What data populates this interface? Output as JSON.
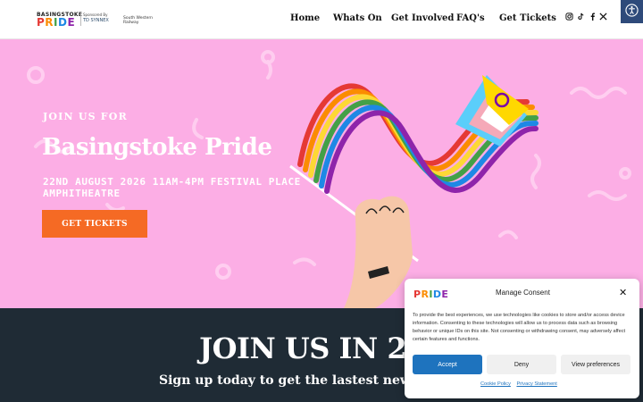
{
  "header": {
    "logo_top": "BASINGSTOKE",
    "logo_letters": [
      "P",
      "R",
      "I",
      "D",
      "E"
    ],
    "sponsored_by": "Sponsored By",
    "sponsor_1": "TD SYNNEX",
    "sponsor_2": "South Western Railway",
    "nav": [
      "Home",
      "Whats On",
      "Get Involved",
      "FAQ's",
      "Get Tickets"
    ],
    "socials": [
      "instagram-icon",
      "tiktok-icon",
      "facebook-icon",
      "x-icon"
    ],
    "accessibility_icon": "accessibility-icon"
  },
  "hero": {
    "kicker": "JOIN US FOR",
    "title": "Basingstoke Pride",
    "date": "22ND AUGUST 2026 11AM-4PM FESTIVAL PLACE AMPHITHEATRE",
    "cta": "GET TICKETS",
    "background": "#fcaee5"
  },
  "signup": {
    "heading": "JOIN US IN 20",
    "subheading": "Sign up today to get the lastest news from o"
  },
  "consent": {
    "logo_letters": [
      "P",
      "R",
      "I",
      "D",
      "E"
    ],
    "title": "Manage Consent",
    "body": "To provide the best experiences, we use technologies like cookies to store and/or access device information. Consenting to these technologies will allow us to process data such as browsing behavior or unique IDs on this site. Not consenting or withdrawing consent, may adversely affect certain features and functions.",
    "accept": "Accept",
    "deny": "Deny",
    "preferences": "View preferences",
    "cookie_policy": "Cookie Policy",
    "privacy_statement": "Privacy Statement",
    "accent": "#1e73be"
  }
}
